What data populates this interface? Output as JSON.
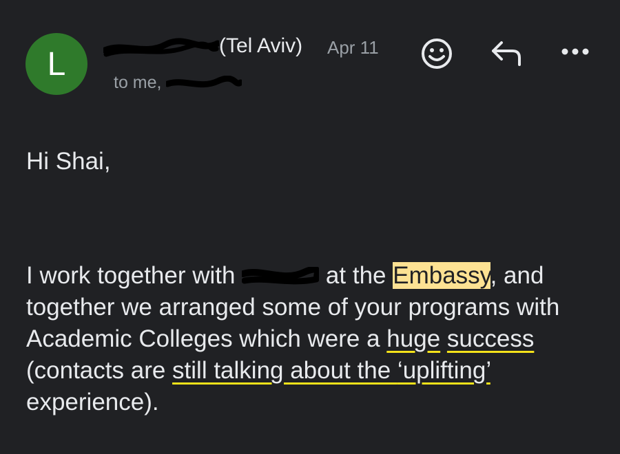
{
  "avatar": {
    "letter": "L",
    "color": "#2f7a2b"
  },
  "sender": {
    "name_suffix": "(Tel Aviv)"
  },
  "date": "Apr 11",
  "recipients": {
    "prefix": "to me,"
  },
  "icons": {
    "react": "emoji-smile-icon",
    "reply": "reply-icon",
    "more": "more-horizontal-icon"
  },
  "message": {
    "greeting": "Hi Shai,",
    "p1_before_redaction": "I work together with ",
    "p1_after_redaction": " at the ",
    "highlighted_word": "Embassy",
    "p1_line1_end": ", and",
    "p1_line2": "together we arranged some of your programs",
    "p1_line3_start": "with Academic Colleges which were a ",
    "underline_huge": "huge",
    "underline_success": "success",
    "p1_middle": " (contacts are ",
    "underline_still": "still talking about the ",
    "underline_uplifting": "‘uplifting’",
    "p1_end": " experience)."
  },
  "colors": {
    "background": "#202124",
    "highlight": "#fde293",
    "underline": "#f5e31a",
    "muted_text": "#9aa0a6"
  }
}
